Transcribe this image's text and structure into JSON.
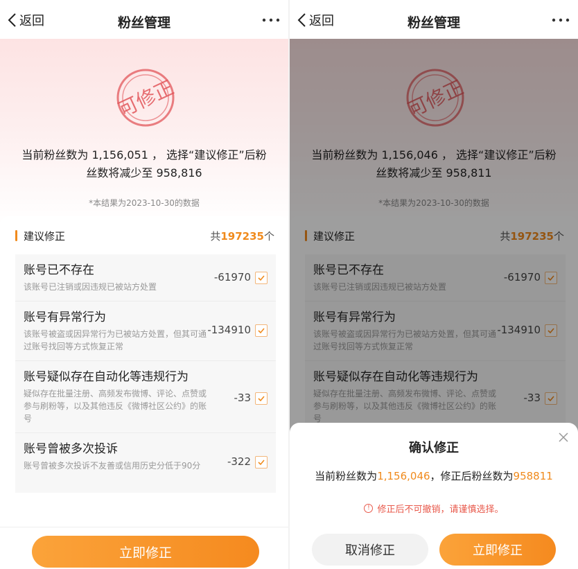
{
  "colors": {
    "accent": "#f08a1c",
    "warning": "#e8594b",
    "stamp": "#e2575b"
  },
  "nav": {
    "back_label": "返回",
    "title": "粉丝管理",
    "more_icon": "more-dots-icon"
  },
  "left": {
    "stamp_text": "可修正",
    "hero_line1": "当前粉丝数为 1,156,051 ， 选择“建议修正”后粉",
    "hero_line2": "丝数将减少至 958,816",
    "note": "*本结果为2023-10-30的数据",
    "section_title": "建议修正",
    "count_prefix": "共",
    "count_number": "197235",
    "count_suffix": "个",
    "items": [
      {
        "title": "账号已不存在",
        "desc": "该账号已注销或因违规已被站方处置",
        "value": "-61970",
        "checked": true
      },
      {
        "title": "账号有异常行为",
        "desc": "该账号被盗或因异常行为已被站方处置，但其可通过账号找回等方式恢复正常",
        "value": "-134910",
        "checked": true
      },
      {
        "title": "账号疑似存在自动化等违规行为",
        "desc": "疑似存在批量注册、高频发布微博、评论、点赞或参与刷粉等，以及其他违反《微博社区公约》的账号",
        "value": "-33",
        "checked": true
      },
      {
        "title": "账号曾被多次投诉",
        "desc": "账号曾被多次投诉不友善或信用历史分低于90分",
        "value": "-322",
        "checked": true
      }
    ],
    "primary_button": "立即修正"
  },
  "right": {
    "stamp_text": "可修正",
    "hero_line1": "当前粉丝数为 1,156,046 ， 选择“建议修正”后粉",
    "hero_line2": "丝数将减少至 958,811",
    "note": "*本结果为2023-10-30的数据",
    "section_title": "建议修正",
    "count_prefix": "共",
    "count_number": "197235",
    "count_suffix": "个",
    "items": [
      {
        "title": "账号已不存在",
        "desc": "该账号已注销或因违规已被站方处置",
        "value": "-61970",
        "checked": true
      },
      {
        "title": "账号有异常行为",
        "desc": "该账号被盗或因异常行为已被站方处置，但其可通过账号找回等方式恢复正常",
        "value": "-134910",
        "checked": true
      },
      {
        "title": "账号疑似存在自动化等违规行为",
        "desc": "疑似存在批量注册、高频发布微博、评论、点赞或参与刷粉等，以及其他违反《微博社区公约》的账号",
        "value": "-33",
        "checked": true
      }
    ],
    "dialog": {
      "title": "确认修正",
      "body_prefix": "当前粉丝数为",
      "body_current": "1,156,046",
      "body_middle": "，修正后粉丝数为",
      "body_after": "958811",
      "warning": "修正后不可撤销，请谨慎选择。",
      "cancel_button": "取消修正",
      "confirm_button": "立即修正"
    }
  }
}
